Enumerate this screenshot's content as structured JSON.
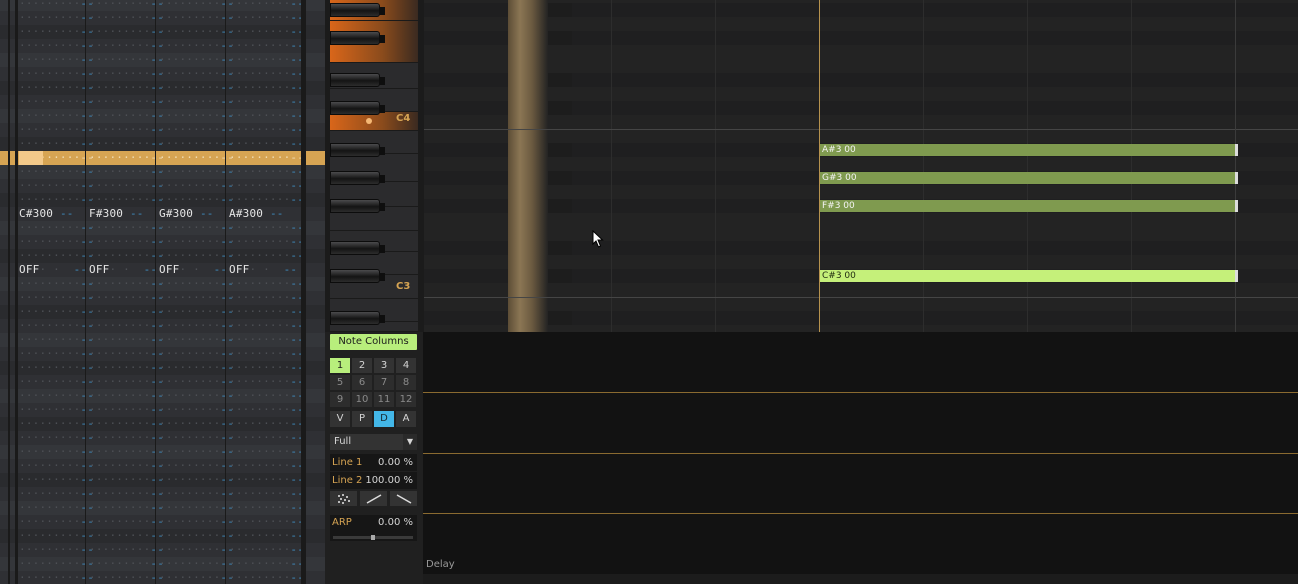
{
  "pattern_editor": {
    "columns": [
      {
        "note": "C#3",
        "instr": "00",
        "off": "OFF"
      },
      {
        "note": "F#3",
        "instr": "00",
        "off": "OFF"
      },
      {
        "note": "G#3",
        "instr": "00",
        "off": "OFF"
      },
      {
        "note": "A#3",
        "instr": "00",
        "off": "OFF"
      }
    ]
  },
  "keyboard": {
    "labels": [
      "C4",
      "C3"
    ]
  },
  "piano_roll": {
    "notes": [
      {
        "label": "A#3 00",
        "style": "dim"
      },
      {
        "label": "G#3 00",
        "style": "dim"
      },
      {
        "label": "F#3 00",
        "style": "dim"
      },
      {
        "label": "C#3 00",
        "style": "bright"
      }
    ]
  },
  "panel": {
    "note_columns_label": "Note Columns",
    "column_buttons": [
      "1",
      "2",
      "3",
      "4",
      "5",
      "6",
      "7",
      "8",
      "9",
      "10",
      "11",
      "12"
    ],
    "selected_column": "1",
    "mode_buttons": [
      "V",
      "P",
      "D",
      "A"
    ],
    "selected_mode": "D",
    "range_select": "Full",
    "line1": {
      "label": "Line 1",
      "value": "0.00 %"
    },
    "line2": {
      "label": "Line 2",
      "value": "100.00 %"
    },
    "arp": {
      "label": "ARP",
      "value": "0.00 %",
      "level": 0.5
    }
  },
  "automation": {
    "lane_label": "Delay"
  }
}
